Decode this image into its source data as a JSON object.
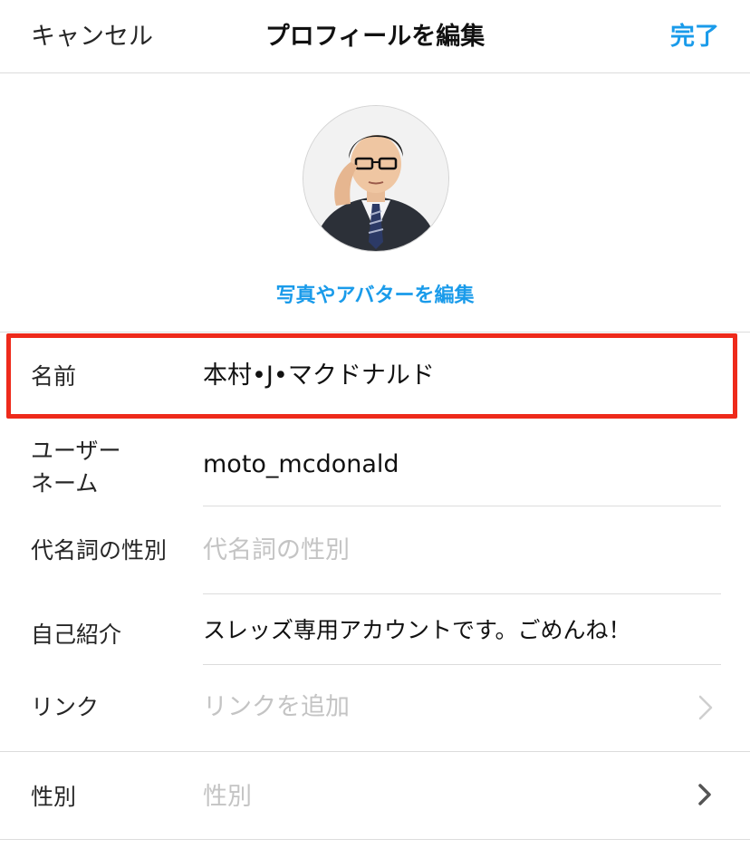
{
  "nav": {
    "cancel_label": "キャンセル",
    "title": "プロフィールを編集",
    "done_label": "完了"
  },
  "profile": {
    "edit_photo_label": "写真やアバターを編集"
  },
  "fields": {
    "name": {
      "label": "名前",
      "value": "本村•J•マクドナルド"
    },
    "username": {
      "label_line1": "ユーザー",
      "label_line2": "ネーム",
      "value": "moto_mcdonald"
    },
    "pronouns": {
      "label": "代名詞の性別",
      "placeholder": "代名詞の性別"
    },
    "bio": {
      "label": "自己紹介",
      "value": "スレッズ専用アカウントです。ごめんね！"
    },
    "link": {
      "label": "リンク",
      "placeholder": "リンクを追加"
    },
    "gender": {
      "label": "性別",
      "placeholder": "性別"
    }
  },
  "colors": {
    "accent": "#1a9bea",
    "highlight": "#ee2a1b",
    "placeholder": "#c4c4c4",
    "separator": "#dcdcdc"
  },
  "icons": [
    "chevron-right-icon",
    "chevron-right-icon"
  ]
}
